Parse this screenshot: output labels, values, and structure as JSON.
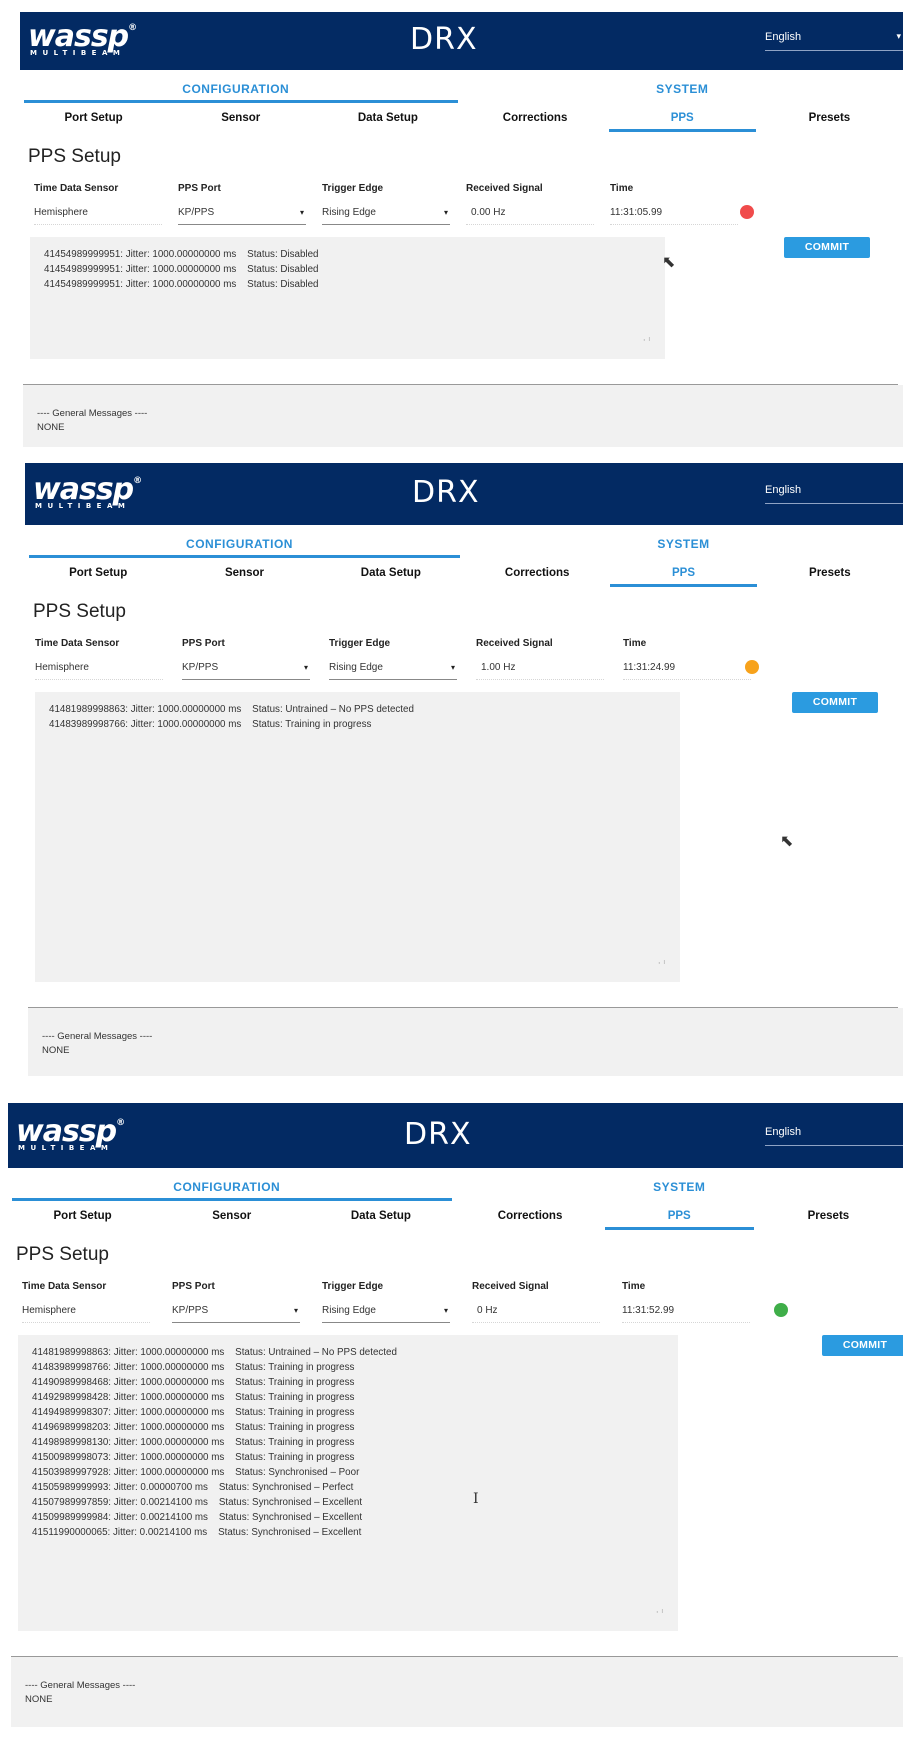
{
  "brand": {
    "logo_text": "wassp",
    "logo_sub": "MULTIBEAM",
    "logo_reg": "®",
    "product": "DRX"
  },
  "language": {
    "value": "English",
    "caret": "▾"
  },
  "groups": {
    "configuration": "CONFIGURATION",
    "system": "SYSTEM"
  },
  "tabs": {
    "port_setup": "Port Setup",
    "sensor": "Sensor",
    "data_setup": "Data Setup",
    "corrections": "Corrections",
    "pps": "PPS",
    "presets": "Presets"
  },
  "page_title": "PPS Setup",
  "labels": {
    "time_data_sensor": "Time Data Sensor",
    "pps_port": "PPS Port",
    "trigger_edge": "Trigger Edge",
    "received_signal": "Received Signal",
    "time": "Time"
  },
  "values": {
    "time_data_sensor": "Hemisphere",
    "pps_port": "KP/PPS",
    "trigger_edge": "Rising Edge",
    "select_caret": "▾"
  },
  "commit_label": "COMMIT",
  "general_messages": {
    "title": "---- General Messages ----",
    "body": "NONE"
  },
  "status_colors": {
    "disabled": "#f04b4b",
    "training": "#f7a21b",
    "synchronised": "#3fae49"
  },
  "accent_color": "#2b8fd6",
  "header_color": "#032a63",
  "snapshots": [
    {
      "received_signal": "0.00 Hz",
      "time": "11:31:05.99",
      "status": "disabled",
      "log": [
        "41454989999951: Jitter: 1000.00000000 ms    Status: Disabled",
        "41454989999951: Jitter: 1000.00000000 ms    Status: Disabled",
        "41454989999951: Jitter: 1000.00000000 ms    Status: Disabled"
      ]
    },
    {
      "received_signal": "1.00 Hz",
      "time": "11:31:24.99",
      "status": "training",
      "log": [
        "41481989998863: Jitter: 1000.00000000 ms    Status: Untrained – No PPS detected",
        "41483989998766: Jitter: 1000.00000000 ms    Status: Training in progress"
      ]
    },
    {
      "received_signal": "0 Hz",
      "time": "11:31:52.99",
      "status": "synchronised",
      "log": [
        "41481989998863: Jitter: 1000.00000000 ms    Status: Untrained – No PPS detected",
        "41483989998766: Jitter: 1000.00000000 ms    Status: Training in progress",
        "41490989998468: Jitter: 1000.00000000 ms    Status: Training in progress",
        "41492989998428: Jitter: 1000.00000000 ms    Status: Training in progress",
        "41494989998307: Jitter: 1000.00000000 ms    Status: Training in progress",
        "41496989998203: Jitter: 1000.00000000 ms    Status: Training in progress",
        "41498989998130: Jitter: 1000.00000000 ms    Status: Training in progress",
        "41500989998073: Jitter: 1000.00000000 ms    Status: Training in progress",
        "41503989997928: Jitter: 1000.00000000 ms    Status: Synchronised – Poor",
        "41505989999993: Jitter: 0.00000700 ms    Status: Synchronised – Perfect",
        "41507989997859: Jitter: 0.00214100 ms    Status: Synchronised – Excellent",
        "41509989999984: Jitter: 0.00214100 ms    Status: Synchronised – Excellent",
        "41511990000065: Jitter: 0.00214100 ms    Status: Synchronised – Excellent"
      ]
    }
  ]
}
